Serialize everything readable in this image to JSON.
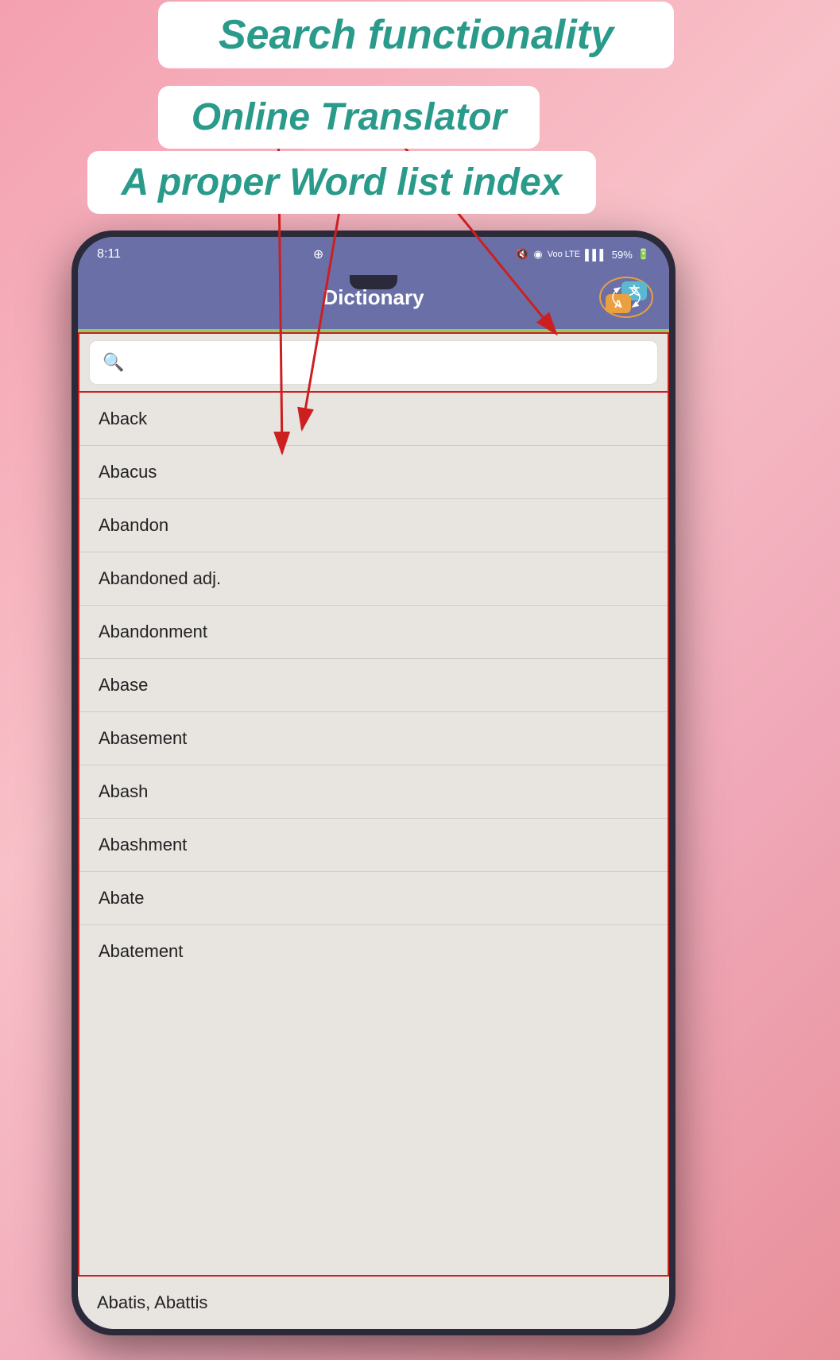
{
  "annotations": {
    "search": "Search functionality",
    "translator": "Online Translator",
    "wordlist": "A proper Word list index"
  },
  "phone": {
    "statusBar": {
      "time": "8:11",
      "whatsappIcon": "⊕",
      "muteIcon": "🔇",
      "wifiIcon": "◉",
      "networkIcon": "Voo LTE",
      "signalIcon": "▌▌▌",
      "battery": "59%"
    },
    "header": {
      "title": "Dictionary",
      "translateBtn": {
        "zh": "文",
        "en": "A"
      }
    },
    "searchPlaceholder": "",
    "words": [
      "Aback",
      "Abacus",
      "Abandon",
      "Abandoned adj.",
      "Abandonment",
      "Abase",
      "Abasement",
      "Abash",
      "Abashment",
      "Abate",
      "Abatement"
    ],
    "bottomWord": "Abatis, Abattis"
  },
  "colors": {
    "annotationText": "#2a9a8a",
    "phoneBg": "#2a2a3a",
    "headerBg": "#6a6fa8",
    "accentGreen": "#90cc60",
    "redBorder": "#cc2020",
    "wordListBg": "#e8e4e0",
    "arrowColor": "#cc2020"
  }
}
